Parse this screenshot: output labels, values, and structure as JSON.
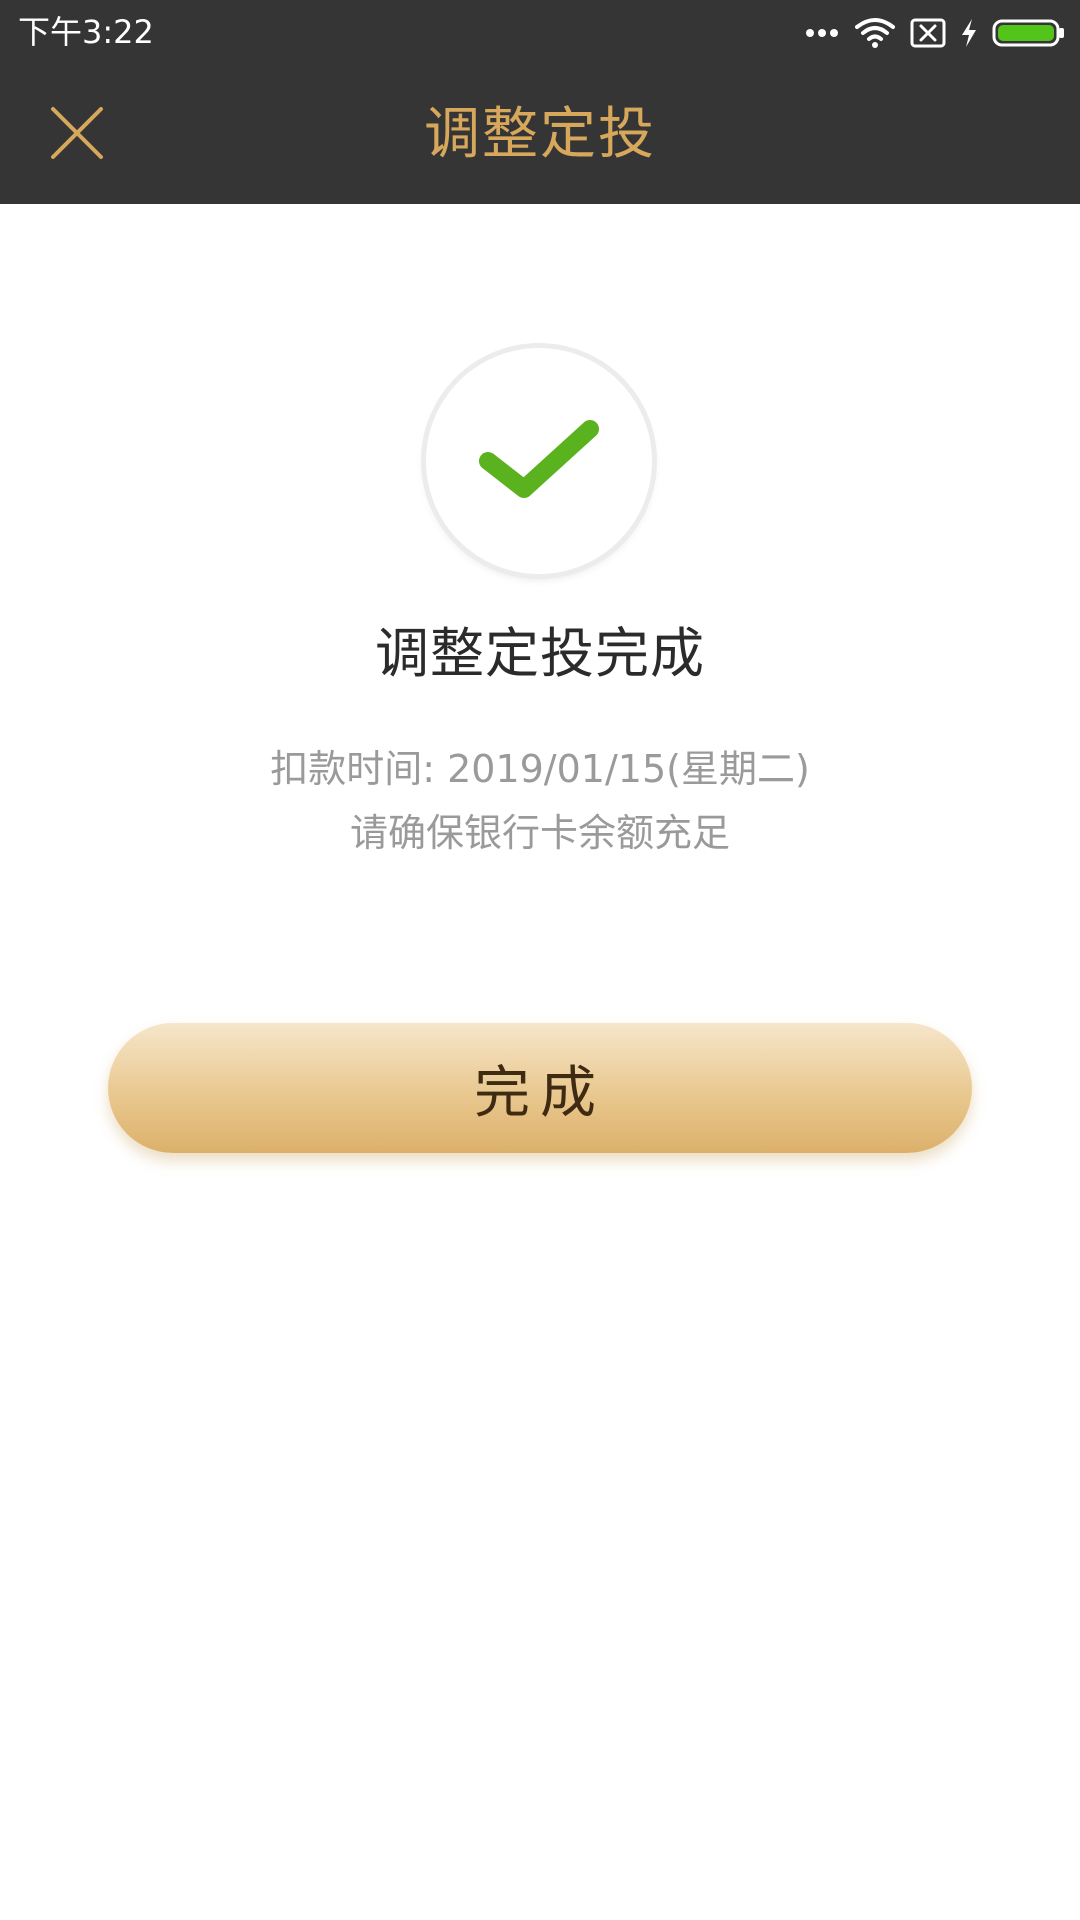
{
  "status_bar": {
    "time": "下午3:22",
    "icons": [
      "more-dots-icon",
      "wifi-icon",
      "sim-blocked-icon",
      "charging-bolt-icon",
      "battery-icon"
    ],
    "battery_color": "#52c41a"
  },
  "header": {
    "title": "调整定投",
    "close_icon": "close-icon",
    "accent_color": "#d7a85c",
    "background_color": "#353535"
  },
  "result": {
    "icon": "check-icon",
    "check_color": "#5ab31e",
    "title": "调整定投完成",
    "deduct_time": "扣款时间: 2019/01/15(星期二)",
    "hint": "请确保银行卡余额充足"
  },
  "actions": {
    "done_label": "完成"
  }
}
